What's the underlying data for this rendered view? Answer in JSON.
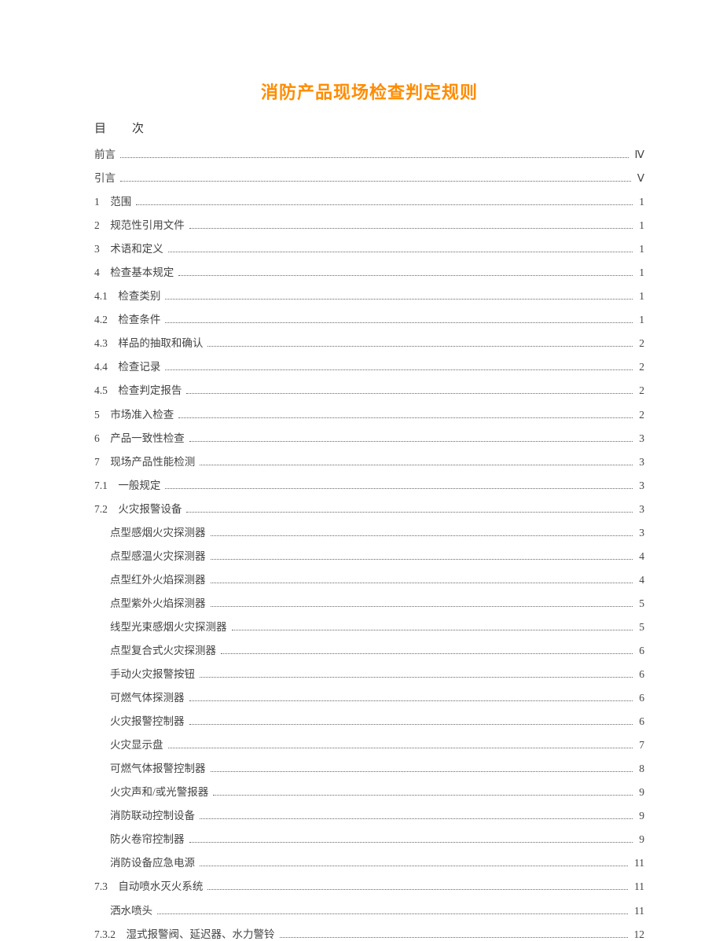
{
  "title": "消防产品现场检查判定规则",
  "toc_header": "目　　次",
  "entries": [
    {
      "label": "前言",
      "page": "Ⅳ",
      "indent": 0
    },
    {
      "label": "引言",
      "page": "Ⅴ",
      "indent": 0
    },
    {
      "label": "1　范围",
      "page": "1",
      "indent": 0
    },
    {
      "label": "2　规范性引用文件",
      "page": "1",
      "indent": 0
    },
    {
      "label": "3　术语和定义",
      "page": "1",
      "indent": 0
    },
    {
      "label": "4　检查基本规定",
      "page": "1",
      "indent": 0
    },
    {
      "label": "4.1　检查类别",
      "page": "1",
      "indent": 0
    },
    {
      "label": "4.2　检查条件",
      "page": "1",
      "indent": 0
    },
    {
      "label": "4.3　样品的抽取和确认",
      "page": "2",
      "indent": 0
    },
    {
      "label": "4.4　检查记录",
      "page": "2",
      "indent": 0
    },
    {
      "label": "4.5　检查判定报告",
      "page": "2",
      "indent": 0
    },
    {
      "label": "5　市场准入检查",
      "page": "2",
      "indent": 0
    },
    {
      "label": "6　产品一致性检查",
      "page": "3",
      "indent": 0
    },
    {
      "label": "7　现场产品性能检测",
      "page": "3",
      "indent": 0
    },
    {
      "label": "7.1　一般规定",
      "page": "3",
      "indent": 0
    },
    {
      "label": "7.2　火灾报警设备",
      "page": "3",
      "indent": 0
    },
    {
      "label": "点型感烟火灾探测器",
      "page": "3",
      "indent": 1
    },
    {
      "label": "点型感温火灾探测器",
      "page": "4",
      "indent": 1
    },
    {
      "label": "点型红外火焰探测器",
      "page": "4",
      "indent": 1
    },
    {
      "label": "点型紫外火焰探测器",
      "page": "5",
      "indent": 1
    },
    {
      "label": "线型光束感烟火灾探测器",
      "page": "5",
      "indent": 1
    },
    {
      "label": "点型复合式火灾探测器",
      "page": "6",
      "indent": 1
    },
    {
      "label": "手动火灾报警按钮",
      "page": "6",
      "indent": 1
    },
    {
      "label": "可燃气体探测器",
      "page": "6",
      "indent": 1
    },
    {
      "label": "火灾报警控制器",
      "page": "6",
      "indent": 1
    },
    {
      "label": "火灾显示盘",
      "page": "7",
      "indent": 1
    },
    {
      "label": "可燃气体报警控制器",
      "page": "8",
      "indent": 1
    },
    {
      "label": "火灾声和/或光警报器",
      "page": "9",
      "indent": 1
    },
    {
      "label": "消防联动控制设备",
      "page": "9",
      "indent": 1
    },
    {
      "label": "防火卷帘控制器",
      "page": "9",
      "indent": 1
    },
    {
      "label": "消防设备应急电源",
      "page": "11",
      "indent": 1
    },
    {
      "label": "7.3　自动喷水灭火系统",
      "page": "11",
      "indent": 0
    },
    {
      "label": "洒水喷头",
      "page": "11",
      "indent": 1
    },
    {
      "label": "7.3.2　湿式报警阀、延迟器、水力警铃",
      "page": "12",
      "indent": 0
    }
  ]
}
